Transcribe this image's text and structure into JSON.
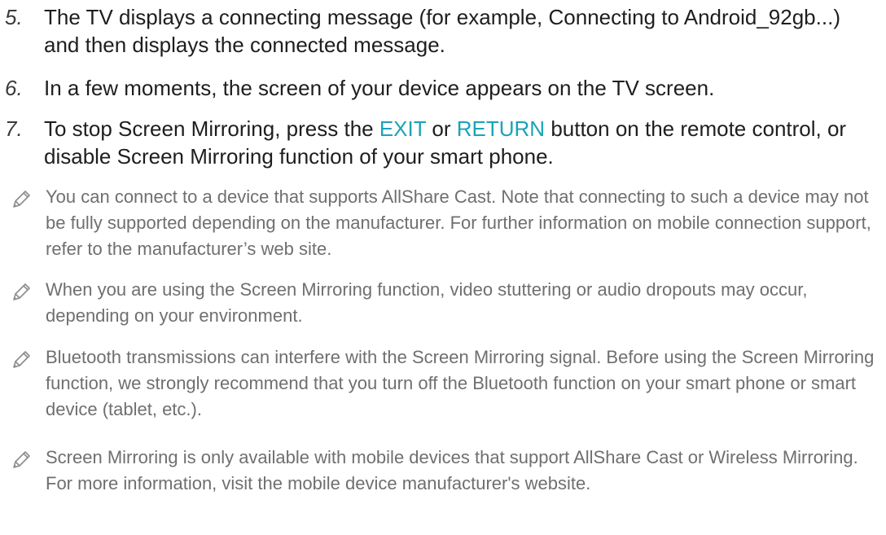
{
  "steps": [
    {
      "num": "5.",
      "text": "The TV displays a connecting message (for example, Connecting to Android_92gb...) and then displays the connected message."
    },
    {
      "num": "6.",
      "text": "In a few moments, the screen of your device appears on the TV screen."
    },
    {
      "num": "7.",
      "before": "To stop Screen Mirroring, press the ",
      "btn1": "EXIT",
      "mid": " or ",
      "btn2": "RETURN",
      "after": " button on the remote control, or disable Screen Mirroring function of your smart phone."
    }
  ],
  "notes": [
    "You can connect to a device that supports AllShare Cast. Note that connecting to such a device may not be fully supported depending on the manufacturer. For further information on mobile connection support, refer to the manufacturer’s web site.",
    "When you are using the Screen Mirroring function, video stuttering or audio dropouts may occur, depending on your environment.",
    "Bluetooth transmissions can interfere with the Screen Mirroring signal. Before using the Screen Mirroring function, we strongly recommend that you turn off the Bluetooth function on your smart phone or smart device (tablet, etc.).",
    "Screen Mirroring is only available with mobile devices that support AllShare Cast or Wireless Mirroring. For more information, visit the mobile device manufacturer's website."
  ],
  "colors": {
    "highlight": "#1aa3b8",
    "body_text": "#1e1e1e",
    "note_text": "#6f6f6f"
  },
  "icons": {
    "note": "pencil-icon"
  }
}
